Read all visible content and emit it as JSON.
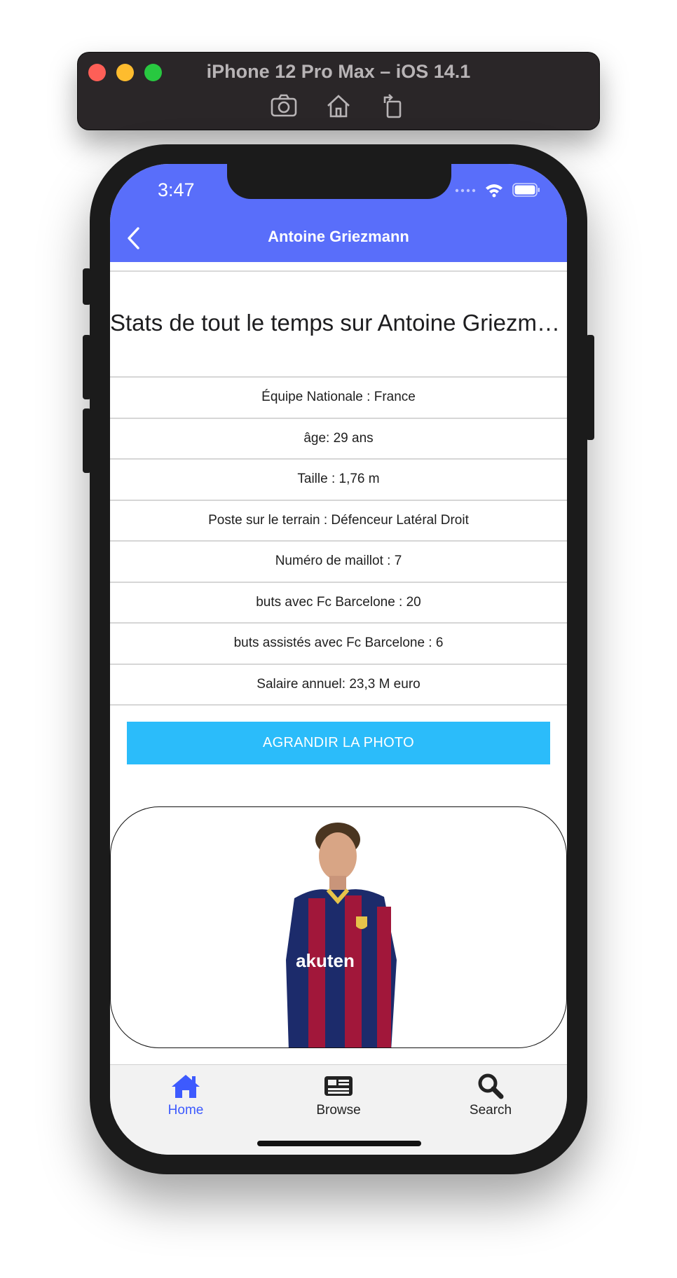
{
  "simulator": {
    "title": "iPhone 12 Pro Max – iOS 14.1",
    "tools": [
      "camera-icon",
      "home-icon",
      "rotate-icon"
    ]
  },
  "status_bar": {
    "time": "3:47",
    "icons": [
      "signal-icon",
      "wifi-icon",
      "battery-icon"
    ]
  },
  "navbar": {
    "title": "Antoine Griezmann",
    "color": "#596efa",
    "back_icon": "chevron-left-icon"
  },
  "page": {
    "heading": "Stats de tout le temps sur Antoine Griezmann",
    "stats": [
      "Équipe Nationale : France",
      "âge: 29 ans",
      "Taille : 1,76 m",
      "Poste sur le terrain : Défenceur Latéral Droit",
      "Numéro de  maillot : 7",
      "buts avec Fc Barcelone  : 20",
      "buts assistés avec Fc Barcelone : 6",
      "Salaire annuel: 23,3 M euro"
    ],
    "enlarge_button": "AGRANDIR LA PHOTO",
    "button_color": "#2bbcfa"
  },
  "tabbar": {
    "tabs": [
      {
        "label": "Home",
        "icon": "house-icon",
        "active": true
      },
      {
        "label": "Browse",
        "icon": "newspaper-icon",
        "active": false
      },
      {
        "label": "Search",
        "icon": "search-icon",
        "active": false
      }
    ],
    "active_color": "#3d5afe"
  }
}
